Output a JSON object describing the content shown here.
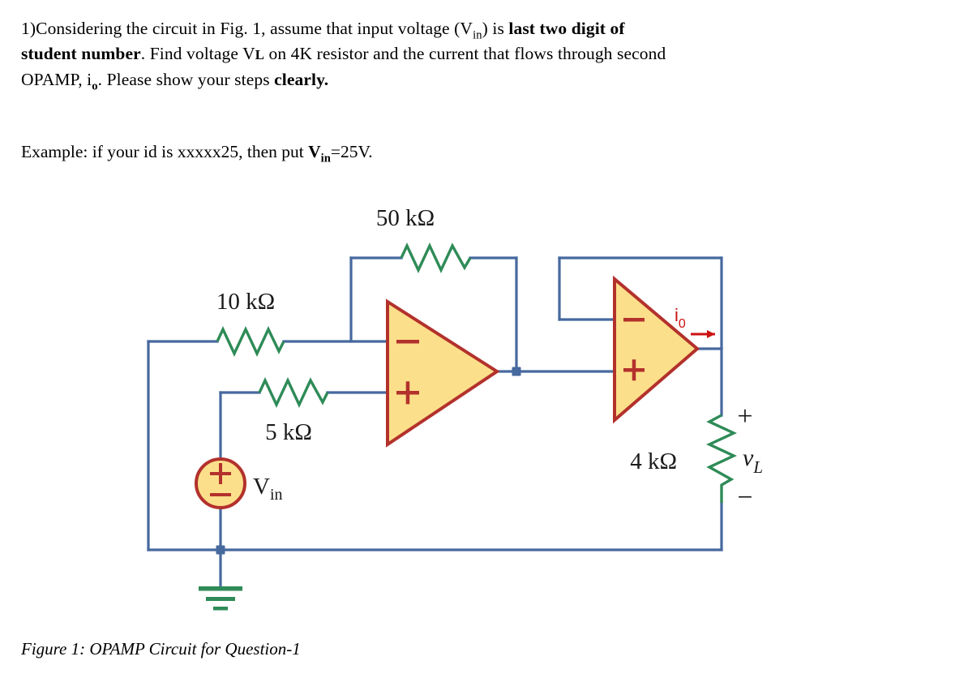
{
  "question": {
    "number": "1)",
    "line1_a": "Considering the circuit in Fig. 1, assume that input voltage (V",
    "line1_sub": "in",
    "line1_b": ") is ",
    "line1_bold": "last two digit of",
    "line2_bold": "student number",
    "line2_a": ". Find voltage V",
    "line2_sub": "L",
    "line2_b": " on 4K resistor  and the current that flows through second",
    "line3_a": "OPAMP, i",
    "line3_sub": "o",
    "line3_b": ". Please show your steps ",
    "line3_bold": "clearly.",
    "example_a": "Example: if your id is xxxxx25, then put ",
    "example_bold": "V",
    "example_bold_sub": "in",
    "example_b": "=25V."
  },
  "figure": {
    "caption": "Figure 1: OPAMP Circuit for Question-1",
    "components": {
      "r_feedback": "50 kΩ",
      "r_input": "10 kΩ",
      "r_plus": "5 kΩ",
      "r_load": "4 kΩ",
      "source": "V",
      "source_sub": "in",
      "current": "i",
      "current_sub": "0",
      "load_voltage": "v",
      "load_voltage_sub": "L",
      "plus_polarity": "+",
      "minus_polarity": "−"
    },
    "opamp1": {
      "inverting": "−",
      "noninverting": "+"
    },
    "opamp2": {
      "inverting": "−",
      "noninverting": "+"
    },
    "colors": {
      "wire": "#46699e",
      "resistor": "#2e8b57",
      "opamp_fill": "#fcdf8a",
      "opamp_stroke": "#b3312c",
      "source_fill": "#fcdf8a",
      "source_stroke": "#b3312c",
      "ground": "#2e8b57",
      "current_arrow": "#cc1111",
      "text": "#1a1a1a"
    }
  }
}
